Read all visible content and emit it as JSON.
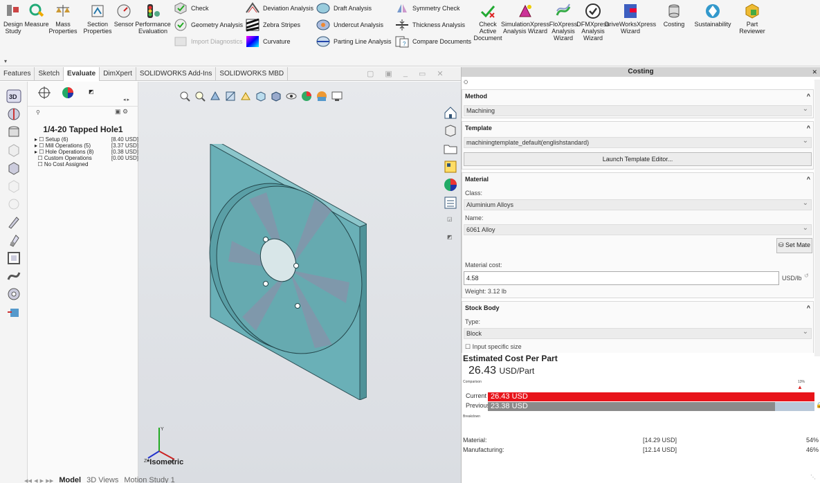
{
  "ribbon": {
    "design_study": "Design Study",
    "measure": "Measure",
    "mass_properties": "Mass Properties",
    "section_properties": "Section Properties",
    "sensor": "Sensor",
    "performance_evaluation": "Performance Evaluation",
    "check": "Check",
    "geometry_analysis": "Geometry Analysis",
    "import_diagnostics": "Import Diagnostics",
    "deviation_analysis": "Deviation Analysis",
    "zebra_stripes": "Zebra Stripes",
    "curvature": "Curvature",
    "draft_analysis": "Draft Analysis",
    "undercut_analysis": "Undercut Analysis",
    "parting_line_analysis": "Parting Line Analysis",
    "symmetry_check": "Symmetry Check",
    "thickness_analysis": "Thickness Analysis",
    "compare_documents": "Compare Documents",
    "check_active_document": "Check Active Document",
    "simulationxpress": "SimulationXpress Analysis Wizard",
    "floxpress": "FloXpress Analysis Wizard",
    "dfmxpress": "DFMXpress Analysis Wizard",
    "driveworksxpress": "DriveWorksXpress Wizard",
    "costing": "Costing",
    "sustainability": "Sustainability",
    "part_reviewer": "Part Reviewer"
  },
  "tabs": [
    "Features",
    "Sketch",
    "Evaluate",
    "DimXpert",
    "SOLIDWORKS Add-Ins",
    "SOLIDWORKS MBD"
  ],
  "feature_manager": {
    "title": "1/4-20 Tapped Hole1",
    "rows": [
      {
        "label": "Setup (6)",
        "value": "[8.40 USD]"
      },
      {
        "label": "Mill Operations (5)",
        "value": "[3.37 USD]"
      },
      {
        "label": "Hole Operations (8)",
        "value": "[0.38 USD]"
      },
      {
        "label": "Custom Operations",
        "value": "[0.00 USD]"
      },
      {
        "label": "No Cost Assigned",
        "value": ""
      }
    ]
  },
  "viewport": {
    "view_label": "*Isometric",
    "bottom_tabs": [
      "Model",
      "3D Views",
      "Motion Study 1"
    ]
  },
  "costing": {
    "title": "Costing",
    "method": {
      "header": "Method",
      "value": "Machining"
    },
    "template": {
      "header": "Template",
      "value": "machiningtemplate_default(englishstandard)",
      "launch": "Launch Template Editor..."
    },
    "material": {
      "header": "Material",
      "class_label": "Class:",
      "class_value": "Aluminium Alloys",
      "name_label": "Name:",
      "name_value": "6061 Alloy",
      "set_button": "Set Mate",
      "cost_label": "Material cost:",
      "cost_value": "4.58",
      "unit": "USD/lb",
      "weight": "Weight: 3.12 lb"
    },
    "stock": {
      "header": "Stock Body",
      "type_label": "Type:",
      "type_value": "Block",
      "specific_size": "Input specific size"
    },
    "estimate": {
      "header": "Estimated Cost Per Part",
      "value": "26.43",
      "unit": "USD/Part",
      "comparison_label": "Comparison",
      "pct_label": "13%",
      "breakdown_label": "Breakdown",
      "current_label": "Current",
      "current_value": "26.43 USD",
      "previous_label": "Previous",
      "previous_value": "23.38 USD",
      "current_fraction": 1.0,
      "previous_fraction": 0.88,
      "material_label": "Material:",
      "material_value": "[14.29 USD]",
      "material_pct": "54%",
      "manufacturing_label": "Manufacturing:",
      "manufacturing_value": "[12.14 USD]",
      "manufacturing_pct": "46%"
    }
  },
  "colors": {
    "part": "#6ab0b7",
    "bar_current": "#e8141a",
    "bar_previous": "#8a8a8a"
  }
}
